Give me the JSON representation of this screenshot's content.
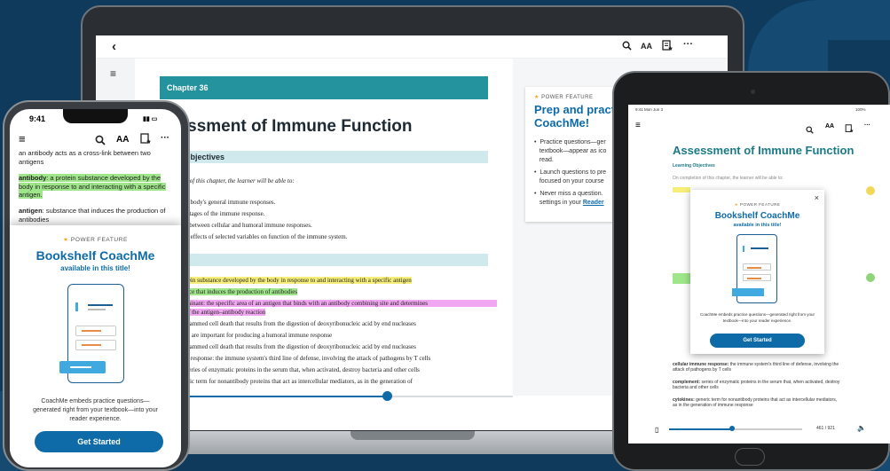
{
  "laptop": {
    "chapter": "Chapter 36",
    "title": "sessment of Immune Function",
    "section1": "ng Objectives",
    "intro": "letion of this chapter, the learner will be able to:",
    "objectives": [
      "be the body's general immune responses.",
      "s the stages of the immune response.",
      "ntiate between cellular and humoral immune responses.",
      "be the effects of selected variables on function of the immune system."
    ],
    "section2": "ory",
    "terms": [
      ": a protein substance developed by the body in response to and interacting with a specific antigen",
      "substance that induces the production of antibodies",
      ": determinant: the specific area of an antigen that binds with an antibody combining site and determines",
      "ficity of the antigen–antibody reaction",
      "s: programmed cell death that results from the digestion of deoxyribonucleic acid by end nucleases",
      "ells that are important for producing a humoral immune response",
      "s: programmed cell death that results from the digestion of deoxyribonucleic acid by end nucleases",
      "mmune response: the immune system's third line of defense, involving the attack of pathogens by T cells",
      "ment: series of enzymatic proteins in the serum that, when activated, destroy bacteria and other cells",
      "s: generic term for nonantibody proteins that act as intercellular mediators, as in the generation of"
    ],
    "panel": {
      "label": "POWER FEATURE",
      "heading_line1": "Prep and practic",
      "heading_line2": "CoachMe!",
      "bullets": [
        [
          "Practice questions—ger",
          "textbook—appear as ico",
          "read."
        ],
        [
          "Launch questions to pre",
          "focused on your course"
        ],
        [
          "Never miss a question.",
          "settings in your "
        ]
      ],
      "link": "Reader"
    }
  },
  "phone": {
    "time": "9:41",
    "lines": [
      "an antibody acts as a cross-link between two",
      "antigens"
    ],
    "antibody_term": "antibody",
    "antibody_def": ": a protein substance developed by the body in response to and interacting with a specific antigen.",
    "antigen_term": "antigen",
    "antigen_def": ": substance that induces the production of antibodies",
    "modal": {
      "label": "POWER FEATURE",
      "title": "Bookshelf CoachMe",
      "subtitle": "available in this title!",
      "desc": "CoachMe embeds practice questions—generated right from your textbook—into your reader experience.",
      "button": "Get Started"
    }
  },
  "tablet": {
    "status": "9:41 Mon Jun 3",
    "battery": "100%",
    "title": "Assessment of Immune Function",
    "objectives_label": "Learning Objectives",
    "intro": "On completion of this chapter, the learner will be able to:",
    "terms": [
      {
        "term": "cellular immune response:",
        "def": " the immune system's third line of defense, involving the attack of pathogens by T cells"
      },
      {
        "term": "complement:",
        "def": " series of enzymatic proteins in the serum that, when activated, destroy bacteria and other cells"
      },
      {
        "term": "cytokines:",
        "def": " generic term for nonantibody proteins that act as intercellular mediators, as in the generation of immune response"
      }
    ],
    "page": "461 / 921",
    "modal": {
      "close": "×",
      "label": "POWER FEATURE",
      "title": "Bookshelf CoachMe",
      "subtitle": "available in this title!",
      "desc": "CoachMe embeds practice questions—generated right from your textbook—into your reader experience.",
      "button": "Get Started"
    }
  },
  "icons": {
    "back": "‹",
    "search": "⌕",
    "text_size": "AA",
    "more": "···",
    "menu": "≡"
  }
}
